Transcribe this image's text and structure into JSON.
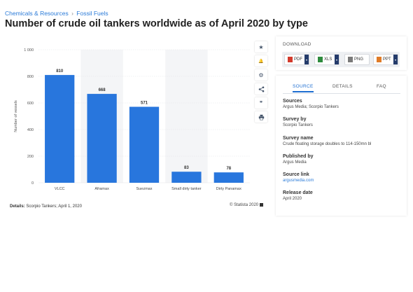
{
  "breadcrumb": {
    "parent": "Chemicals & Resources",
    "separator": "›",
    "current": "Fossil Fuels"
  },
  "title": "Number of crude oil tankers worldwide as of April 2020 by type",
  "chart_data": {
    "type": "bar",
    "categories": [
      "VLCC",
      "Aframax",
      "Suezmax",
      "Small dirty tanker",
      "Dirty Panamax"
    ],
    "values": [
      810,
      668,
      571,
      83,
      78
    ],
    "data_labels": [
      "810",
      "668",
      "571",
      "83",
      "78"
    ],
    "ylabel": "Number of vessels",
    "ylim": [
      0,
      1000
    ],
    "yticks": [
      0,
      200,
      400,
      600,
      800,
      1000
    ],
    "ytick_labels": [
      "0",
      "200",
      "400",
      "600",
      "800",
      "1 000"
    ],
    "bar_color": "#2876dd",
    "grid": true,
    "alternating_bands": true
  },
  "details": {
    "label": "Details:",
    "text": "Scorpio Tankers; April 1, 2020"
  },
  "copyright": "© Statista 2020",
  "tools": [
    {
      "name": "star-icon",
      "glyph": "★"
    },
    {
      "name": "bell-icon",
      "glyph": "🔔"
    },
    {
      "name": "gear-icon",
      "glyph": "⚙"
    },
    {
      "name": "share-icon",
      "glyph": "<"
    },
    {
      "name": "quote-icon",
      "glyph": "❞"
    },
    {
      "name": "print-icon",
      "glyph": "⎙"
    }
  ],
  "download": {
    "title": "DOWNLOAD",
    "buttons": [
      {
        "label": "PDF",
        "icon_color": "#d33a2c"
      },
      {
        "label": "XLS",
        "icon_color": "#2e8b3e"
      },
      {
        "label": "PNG",
        "icon_color": "#7a7a7a"
      },
      {
        "label": "PPT",
        "icon_color": "#e07b27"
      }
    ]
  },
  "tabs": [
    {
      "label": "SOURCE",
      "active": true
    },
    {
      "label": "DETAILS",
      "active": false
    },
    {
      "label": "FAQ",
      "active": false
    }
  ],
  "source": {
    "sources_label": "Sources",
    "sources_value": "Argus Media; Scorpio Tankers",
    "survey_by_label": "Survey by",
    "survey_by_value": "Scorpio Tankers",
    "survey_name_label": "Survey name",
    "survey_name_value": "Crude floating storage doubles to 114-150mn bl",
    "published_by_label": "Published by",
    "published_by_value": "Argus Media",
    "source_link_label": "Source link",
    "source_link_value": "argusmedia.com",
    "release_date_label": "Release date",
    "release_date_value": "April 2020"
  }
}
